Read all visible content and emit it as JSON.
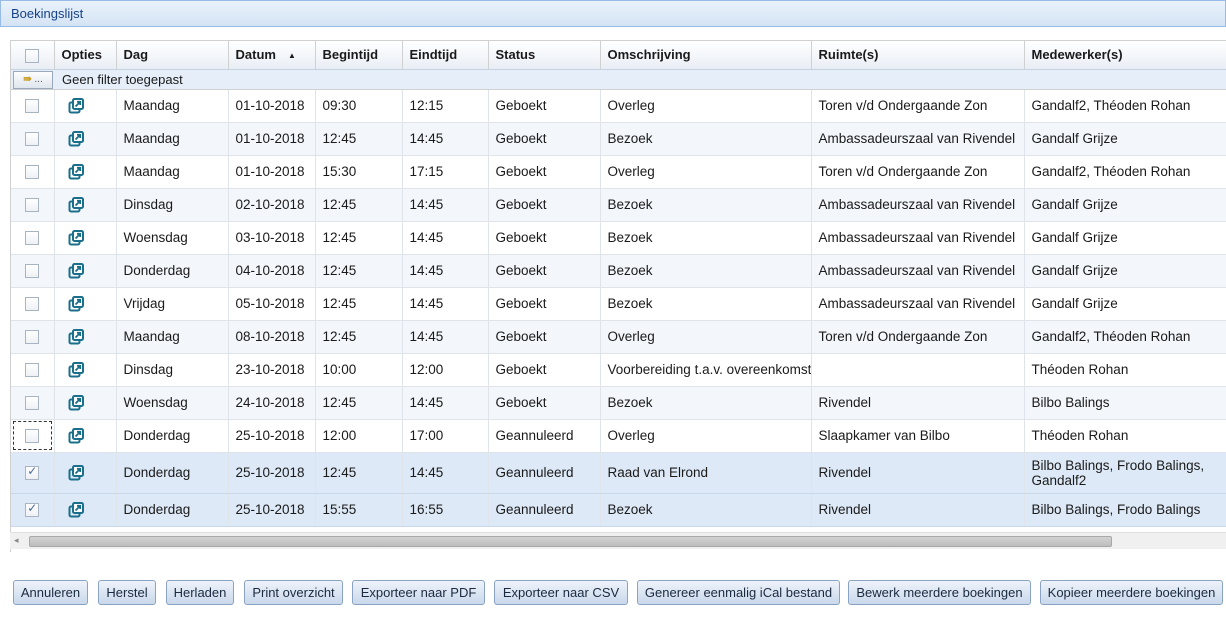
{
  "window": {
    "title": "Boekingslijst"
  },
  "columns": {
    "options": "Opties",
    "day": "Dag",
    "date": "Datum",
    "start": "Begintijd",
    "end": "Eindtijd",
    "status": "Status",
    "description": "Omschrijving",
    "rooms": "Ruimte(s)",
    "employees": "Medewerker(s)",
    "sort_indicator": "▲"
  },
  "filter": {
    "text": "Geen filter toegepast",
    "button_label": "..."
  },
  "rows": [
    {
      "checked": false,
      "day": "Maandag",
      "date": "01-10-2018",
      "start": "09:30",
      "end": "12:15",
      "status": "Geboekt",
      "description": "Overleg",
      "rooms": "Toren v/d Ondergaande Zon",
      "employees": "Gandalf2, Théoden Rohan"
    },
    {
      "checked": false,
      "day": "Maandag",
      "date": "01-10-2018",
      "start": "12:45",
      "end": "14:45",
      "status": "Geboekt",
      "description": "Bezoek",
      "rooms": "Ambassadeurszaal van Rivendel",
      "employees": "Gandalf Grijze"
    },
    {
      "checked": false,
      "day": "Maandag",
      "date": "01-10-2018",
      "start": "15:30",
      "end": "17:15",
      "status": "Geboekt",
      "description": "Overleg",
      "rooms": "Toren v/d Ondergaande Zon",
      "employees": "Gandalf2, Théoden Rohan"
    },
    {
      "checked": false,
      "day": "Dinsdag",
      "date": "02-10-2018",
      "start": "12:45",
      "end": "14:45",
      "status": "Geboekt",
      "description": "Bezoek",
      "rooms": "Ambassadeurszaal van Rivendel",
      "employees": "Gandalf Grijze"
    },
    {
      "checked": false,
      "day": "Woensdag",
      "date": "03-10-2018",
      "start": "12:45",
      "end": "14:45",
      "status": "Geboekt",
      "description": "Bezoek",
      "rooms": "Ambassadeurszaal van Rivendel",
      "employees": "Gandalf Grijze"
    },
    {
      "checked": false,
      "day": "Donderdag",
      "date": "04-10-2018",
      "start": "12:45",
      "end": "14:45",
      "status": "Geboekt",
      "description": "Bezoek",
      "rooms": "Ambassadeurszaal van Rivendel",
      "employees": "Gandalf Grijze"
    },
    {
      "checked": false,
      "day": "Vrijdag",
      "date": "05-10-2018",
      "start": "12:45",
      "end": "14:45",
      "status": "Geboekt",
      "description": "Bezoek",
      "rooms": "Ambassadeurszaal van Rivendel",
      "employees": "Gandalf Grijze"
    },
    {
      "checked": false,
      "day": "Maandag",
      "date": "08-10-2018",
      "start": "12:45",
      "end": "14:45",
      "status": "Geboekt",
      "description": "Overleg",
      "rooms": "Toren v/d Ondergaande Zon",
      "employees": "Gandalf2, Théoden Rohan"
    },
    {
      "checked": false,
      "day": "Dinsdag",
      "date": "23-10-2018",
      "start": "10:00",
      "end": "12:00",
      "status": "Geboekt",
      "description": "Voorbereiding t.a.v. overeenkomst",
      "rooms": "",
      "employees": "Théoden Rohan"
    },
    {
      "checked": false,
      "day": "Woensdag",
      "date": "24-10-2018",
      "start": "12:45",
      "end": "14:45",
      "status": "Geboekt",
      "description": "Bezoek",
      "rooms": "Rivendel",
      "employees": "Bilbo Balings"
    },
    {
      "checked": false,
      "day": "Donderdag",
      "date": "25-10-2018",
      "start": "12:00",
      "end": "17:00",
      "status": "Geannuleerd",
      "description": "Overleg",
      "rooms": "Slaapkamer van Bilbo",
      "employees": "Théoden Rohan"
    },
    {
      "checked": true,
      "day": "Donderdag",
      "date": "25-10-2018",
      "start": "12:45",
      "end": "14:45",
      "status": "Geannuleerd",
      "description": "Raad van Elrond",
      "rooms": "Rivendel",
      "employees": "Bilbo Balings, Frodo Balings, Gandalf2"
    },
    {
      "checked": true,
      "day": "Donderdag",
      "date": "25-10-2018",
      "start": "15:55",
      "end": "16:55",
      "status": "Geannuleerd",
      "description": "Bezoek",
      "rooms": "Rivendel",
      "employees": "Bilbo Balings, Frodo Balings"
    }
  ],
  "buttons": {
    "cancel": "Annuleren",
    "restore": "Herstel",
    "reload": "Herladen",
    "print": "Print overzicht",
    "export_pdf": "Exporteer naar PDF",
    "export_csv": "Exporteer naar CSV",
    "ical": "Genereer eenmalig iCal bestand",
    "edit_multiple": "Bewerk meerdere boekingen",
    "copy_multiple": "Kopieer meerdere boekingen"
  },
  "colors": {
    "header_text": "#15428b",
    "selected_row": "#dde9f7",
    "icon": "#1b6f8a"
  },
  "icons": {
    "open": "open-external-icon",
    "filter": "filter-icon"
  }
}
